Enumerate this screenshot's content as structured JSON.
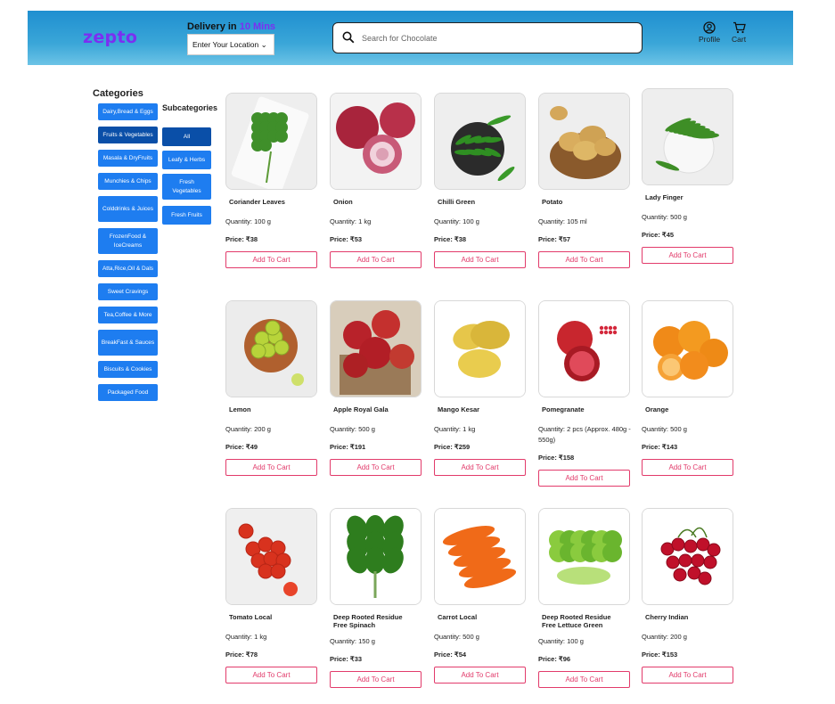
{
  "header": {
    "logo": "zepto",
    "delivery_prefix": "Delivery in ",
    "delivery_time": "10 Mins",
    "location_button": "Enter Your Location",
    "search_placeholder": "Search for Chocolate",
    "profile_label": "Profile",
    "cart_label": "Cart",
    "colors": {
      "header_gradient_top": "#1f8fd0",
      "accent_purple": "#7b2ff2"
    }
  },
  "sidebar": {
    "title": "Categories",
    "categories": [
      "Dairy,Bread & Eggs",
      "Fruits & Vegetables",
      "Masala & DryFruits",
      "Munchies & Chips",
      "Colddrinks & Juices",
      "FrozenFood & IceCreams",
      "Atta,Rice,Oil & Dals",
      "Sweet Cravings",
      "Tea,Coffee & More",
      "BreakFast & Sauces",
      "Biscuits & Cookies",
      "Packaged Food"
    ],
    "active_category": "Fruits & Vegetables",
    "colors": {
      "button": "#1e7df0",
      "active": "#0a4fa8"
    }
  },
  "subcategories": {
    "title": "Subcategories",
    "items": [
      "All",
      "Leafy & Herbs",
      "Fresh Vegetables",
      "Fresh Fruits"
    ],
    "active": "All"
  },
  "products": [
    {
      "name": "Coriander Leaves",
      "quantity": "Quantity: 100 g",
      "price": "Price: ₹38",
      "icon": "coriander"
    },
    {
      "name": "Onion",
      "quantity": "Quantity: 1 kg",
      "price": "Price: ₹53",
      "icon": "onion"
    },
    {
      "name": "Chilli Green",
      "quantity": "Quantity: 100 g",
      "price": "Price: ₹38",
      "icon": "chilli"
    },
    {
      "name": "Potato",
      "quantity": "Quantity: 105 ml",
      "price": "Price: ₹57",
      "icon": "potato"
    },
    {
      "name": "Lady Finger",
      "quantity": "Quantity: 500 g",
      "price": "Price: ₹45",
      "icon": "okra"
    },
    {
      "name": "Lemon",
      "quantity": "Quantity: 200 g",
      "price": "Price: ₹49",
      "icon": "lemon"
    },
    {
      "name": "Apple Royal Gala",
      "quantity": "Quantity: 500 g",
      "price": "Price: ₹191",
      "icon": "apple"
    },
    {
      "name": "Mango Kesar",
      "quantity": "Quantity: 1 kg",
      "price": "Price: ₹259",
      "icon": "mango"
    },
    {
      "name": "Pomegranate",
      "quantity": "Quantity: 2 pcs (Approx. 480g - 550g)",
      "price": "Price: ₹158",
      "icon": "pomegranate"
    },
    {
      "name": "Orange",
      "quantity": "Quantity: 500 g",
      "price": "Price: ₹143",
      "icon": "orange"
    },
    {
      "name": "Tomato Local",
      "quantity": "Quantity: 1 kg",
      "price": "Price: ₹78",
      "icon": "tomato"
    },
    {
      "name": "Deep Rooted Residue Free Spinach",
      "quantity": "Quantity: 150 g",
      "price": "Price: ₹33",
      "icon": "spinach"
    },
    {
      "name": "Carrot Local",
      "quantity": "Quantity: 500 g",
      "price": "Price: ₹54",
      "icon": "carrot"
    },
    {
      "name": "Deep Rooted Residue Free Lettuce Green",
      "quantity": "Quantity: 100 g",
      "price": "Price: ₹96",
      "icon": "lettuce"
    },
    {
      "name": "Cherry Indian",
      "quantity": "Quantity: 200 g",
      "price": "Price: ₹153",
      "icon": "cherry"
    }
  ],
  "add_to_cart_label": "Add To Cart",
  "colors": {
    "add_to_cart": "#e23b6b"
  }
}
